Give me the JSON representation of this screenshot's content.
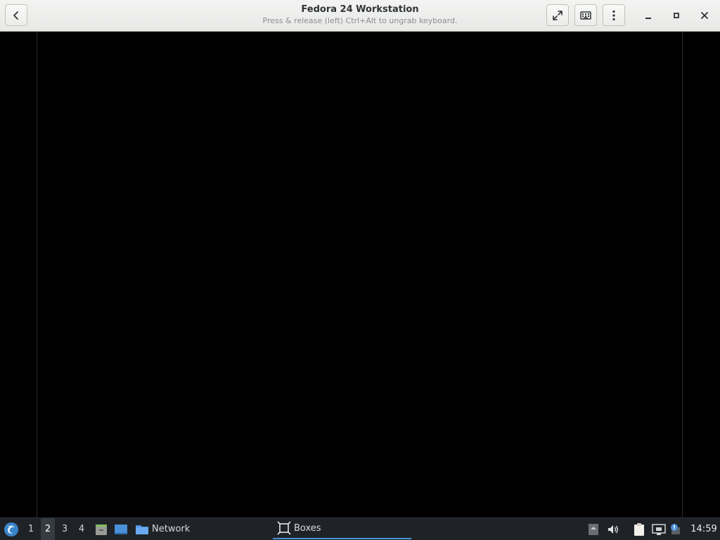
{
  "window": {
    "title": "Fedora 24 Workstation",
    "subtitle": "Press & release (left) Ctrl+Alt to ungrab keyboard."
  },
  "header": {
    "icons": {
      "back": "back-icon",
      "fullscreen": "fullscreen-icon",
      "keyboard": "keyboard-icon",
      "menu": "vertical-dots-icon",
      "minimize": "minimize-icon",
      "maximize": "maximize-icon",
      "close": "close-icon"
    }
  },
  "taskbar": {
    "workspaces": [
      "1",
      "2",
      "3",
      "4"
    ],
    "active_workspace": "2",
    "tasks": [
      {
        "label": "Network",
        "icon": "folder-icon"
      },
      {
        "label": "Boxes",
        "icon": "boxes-app-icon"
      }
    ],
    "clock": "14:59"
  },
  "colors": {
    "header_bg": "#ececea",
    "taskbar_bg": "#1f2327",
    "accent": "#4a90d9",
    "vm_bg": "#000000"
  }
}
